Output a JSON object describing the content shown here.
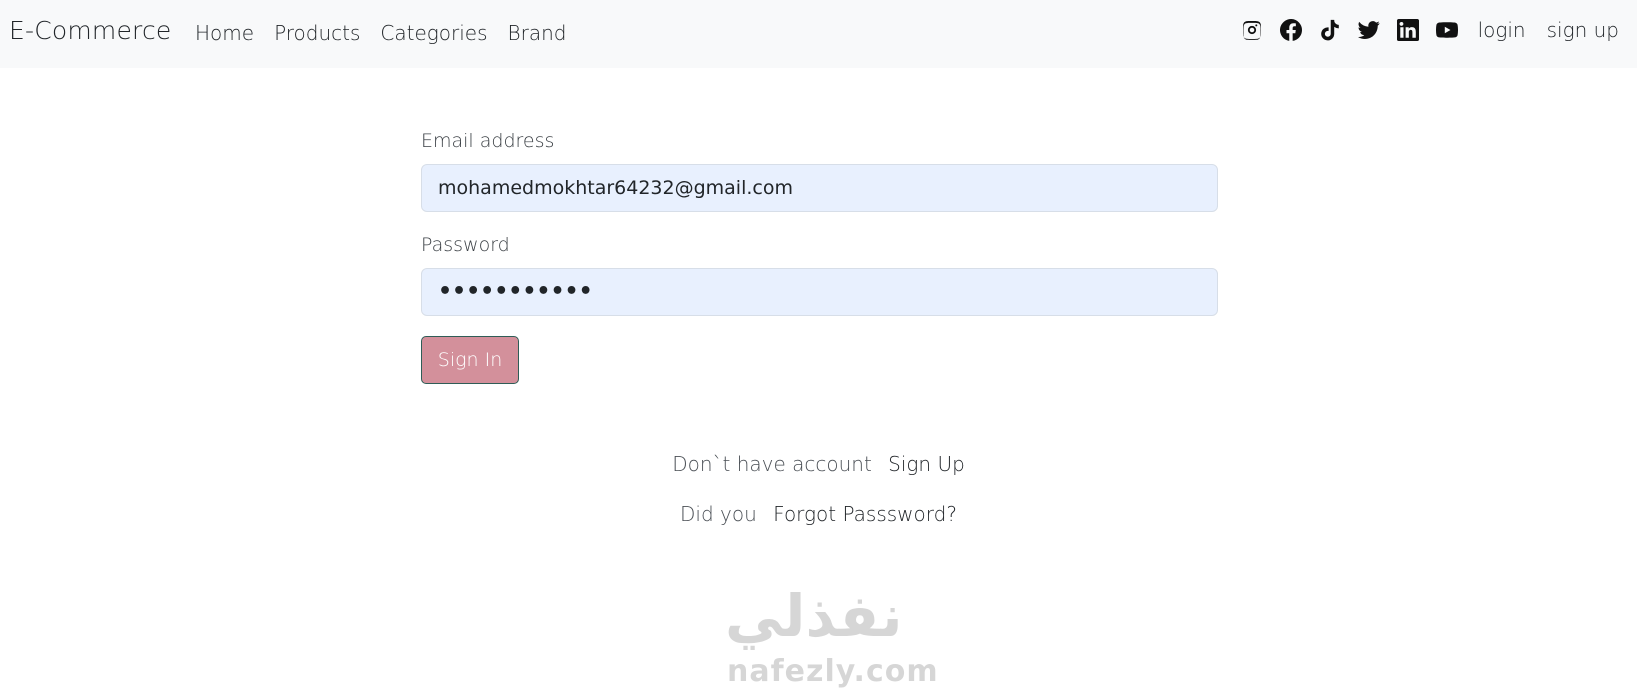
{
  "navbar": {
    "brand": "E-Commerce",
    "links": [
      "Home",
      "Products",
      "Categories",
      "Brand"
    ],
    "social_icons": [
      "instagram-icon",
      "facebook-icon",
      "tiktok-icon",
      "twitter-icon",
      "linkedin-icon",
      "youtube-icon"
    ],
    "login": "login",
    "signup": "sign up"
  },
  "form": {
    "email_label": "Email address",
    "email_value": "mohamedmokhtar64232@gmail.com",
    "password_label": "Password",
    "password_value": "•••••••••••",
    "submit": "Sign In"
  },
  "links": {
    "no_account_text": "Don`t have account",
    "signup_link": "Sign Up",
    "forgot_prefix": "Did you",
    "forgot_link": "Forgot Passsword?"
  },
  "watermark": {
    "arabic": "نفذلي",
    "latin": "nafezly.com"
  },
  "colors": {
    "navbar_bg": "#f8f9fa",
    "input_bg": "#e8f0fe",
    "button_bg": "#d3909b",
    "button_border": "#2f5d57"
  }
}
